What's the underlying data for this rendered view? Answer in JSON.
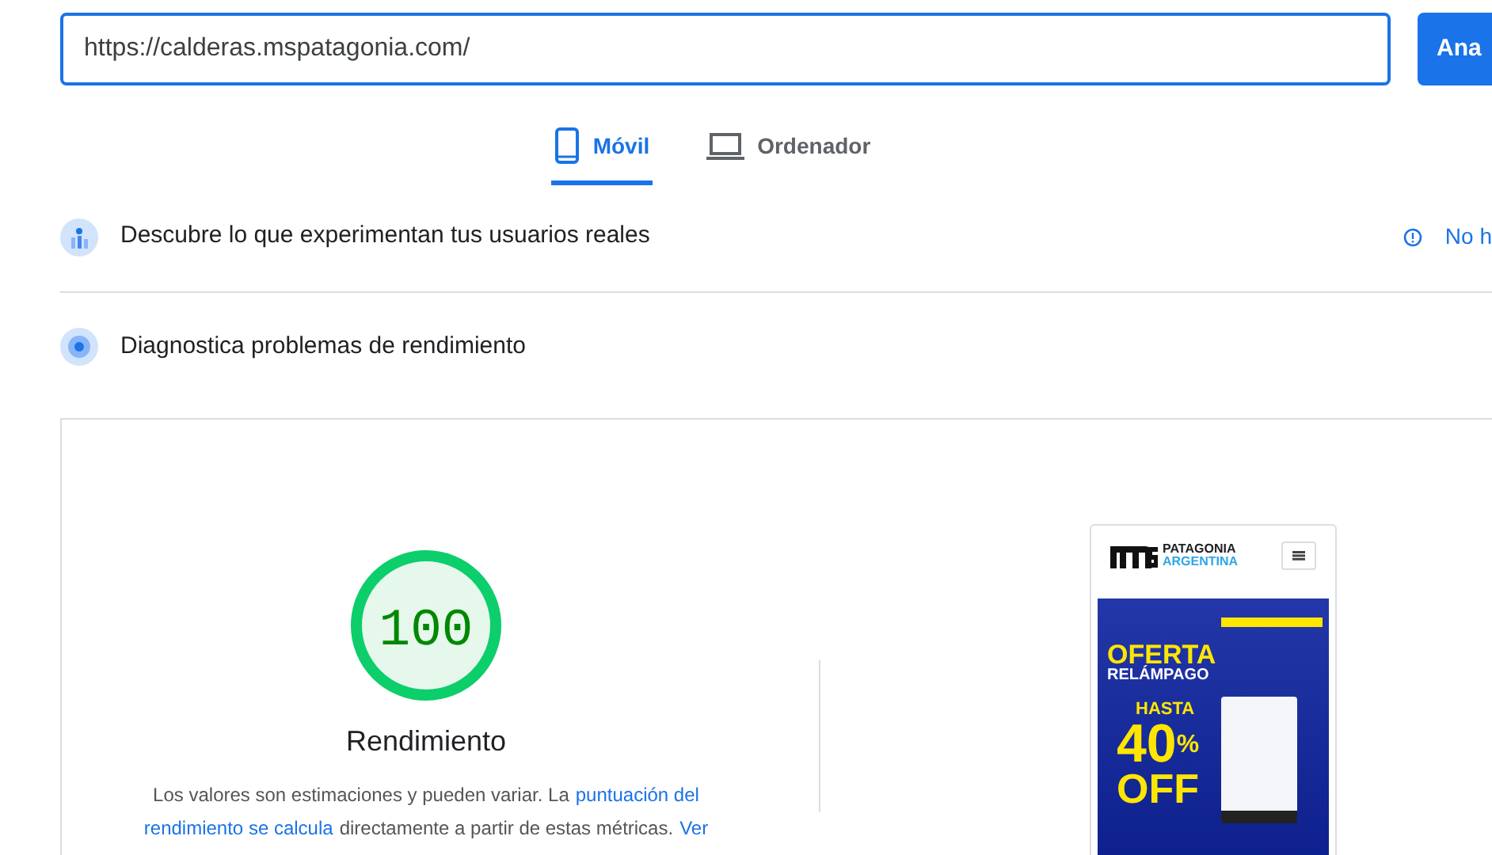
{
  "url_field": {
    "value": "https://calderas.mspatagonia.com/"
  },
  "analyze_button": {
    "label": "Ana"
  },
  "tabs": [
    {
      "label": "Móvil",
      "kind": "phone",
      "selected": true
    },
    {
      "label": "Ordenador",
      "kind": "laptop",
      "selected": false
    }
  ],
  "sections": [
    {
      "title": "Descubre lo que experimentan tus usuarios reales",
      "kind": "users",
      "note": "No h"
    },
    {
      "title": "Diagnostica problemas de rendimiento",
      "kind": "diagnose"
    }
  ],
  "score": {
    "value": "100",
    "level": 1,
    "label": "Rendimiento",
    "description_lines": [
      [
        {
          "kind": "text",
          "text": "Los valores son estimaciones y pueden variar. La"
        },
        {
          "kind": "link",
          "text": "puntuación del"
        }
      ],
      [
        {
          "kind": "link",
          "text": "rendimiento se calcula"
        },
        {
          "kind": "text",
          "text": "directamente a partir de estas métricas."
        },
        {
          "kind": "link",
          "text": "Ver"
        }
      ]
    ]
  },
  "preview": {
    "logo_top": "PATAGONIA",
    "logo_bottom": "ARGENTINA",
    "headline": "OFERTA",
    "subheadline": "RELÁMPAGO",
    "upto": "HASTA",
    "discount": "40",
    "percent": "%",
    "off": "OFF"
  }
}
